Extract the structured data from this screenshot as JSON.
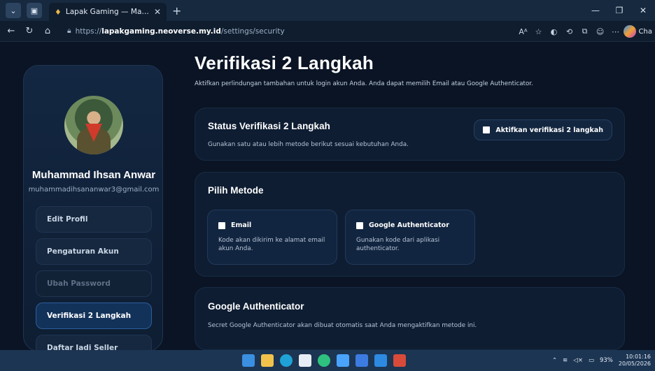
{
  "browser": {
    "tab_title": "Lapak Gaming — Marketplace Gar",
    "new_tab": "+",
    "url_prefix": "https://",
    "url_host": "lapakgaming.neoverse.my.id",
    "url_path": "/settings/security",
    "copilot_label": "Cha"
  },
  "sidebar": {
    "user_name": "Muhammad Ihsan Anwar",
    "user_email": "muhammadihsananwar3@gmail.com",
    "items": [
      {
        "label": "Edit Profil",
        "state": "normal"
      },
      {
        "label": "Pengaturan Akun",
        "state": "normal"
      },
      {
        "label": "Ubah Password",
        "state": "disabled"
      },
      {
        "label": "Verifikasi 2 Langkah",
        "state": "active"
      },
      {
        "label": "Daftar Jadi Seller",
        "state": "normal"
      }
    ]
  },
  "main": {
    "title": "Verifikasi 2 Langkah",
    "subtitle": "Aktifkan perlindungan tambahan untuk login akun Anda. Anda dapat memilih Email atau Google Authenticator.",
    "status_card": {
      "title": "Status Verifikasi 2 Langkah",
      "desc": "Gunakan satu atau lebih metode berikut sesuai kebutuhan Anda.",
      "toggle_label": "Aktifkan verifikasi 2 langkah"
    },
    "method_card": {
      "title": "Pilih Metode",
      "methods": [
        {
          "label": "Email",
          "desc": "Kode akan dikirim ke alamat email akun Anda."
        },
        {
          "label": "Google Authenticator",
          "desc": "Gunakan kode dari aplikasi authenticator."
        }
      ]
    },
    "ga_card": {
      "title": "Google Authenticator",
      "desc": "Secret Google Authenticator akan dibuat otomatis saat Anda mengaktifkan metode ini."
    }
  },
  "taskbar": {
    "battery": "93%",
    "time": "10:01:16",
    "date": "20/05/2026"
  },
  "colors": {
    "page_bg": "#0a1424",
    "card_bg": "#0e1d32",
    "active_item": "#13325a",
    "accent_border": "#2a5f9c"
  }
}
